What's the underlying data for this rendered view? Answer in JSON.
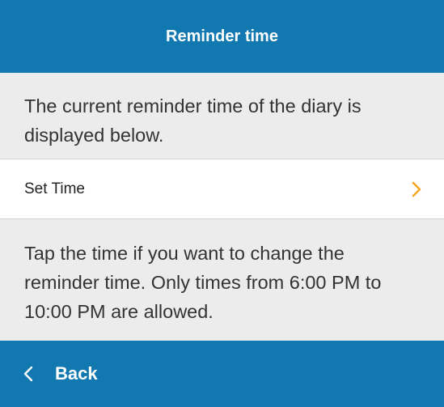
{
  "header": {
    "title": "Reminder time"
  },
  "intro": {
    "text": "The current reminder time of the diary is displayed below."
  },
  "time_row": {
    "label": "Set Time",
    "icon": "chevron-right-icon"
  },
  "help": {
    "text": "Tap the time if you want to change the reminder time. Only times from 6:00 PM to 10:00 PM are allowed."
  },
  "footer": {
    "back_label": "Back",
    "icon": "chevron-left-icon"
  },
  "colors": {
    "brand_blue": "#1278b0",
    "accent_orange": "#f5a623",
    "background": "#ececec"
  }
}
